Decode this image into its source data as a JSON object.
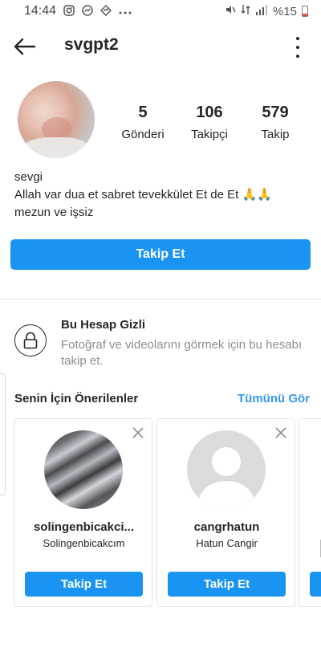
{
  "status_bar": {
    "time": "14:44",
    "battery_text": "%15"
  },
  "profile": {
    "username": "svgpt2",
    "stats": [
      {
        "value": "5",
        "label": "Gönderi"
      },
      {
        "value": "106",
        "label": "Takipçi"
      },
      {
        "value": "579",
        "label": "Takip"
      }
    ],
    "name": "sevgi",
    "bio_line1": "Allah var dua et sabret tevekkület Et de Et 🙏🙏",
    "bio_line2": "mezun ve işsiz",
    "follow_label": "Takip Et"
  },
  "private": {
    "title": "Bu Hesap Gizli",
    "description": "Fotoğraf ve videolarını görmek için bu hesabı takip et."
  },
  "suggestions": {
    "header": "Senin İçin Önerilenler",
    "see_all": "Tümünü Gör",
    "cards": [
      {
        "username": "solingenbicakci...",
        "full_name": "Solingenbicakcım",
        "follow_label": "Takip Et"
      },
      {
        "username": "cangrhatun",
        "full_name": "Hatun Cangir",
        "follow_label": "Takip Et"
      }
    ]
  },
  "colors": {
    "accent": "#1a94f2",
    "link": "#3897f0",
    "text": "#262626",
    "muted": "#8e8e8e"
  }
}
